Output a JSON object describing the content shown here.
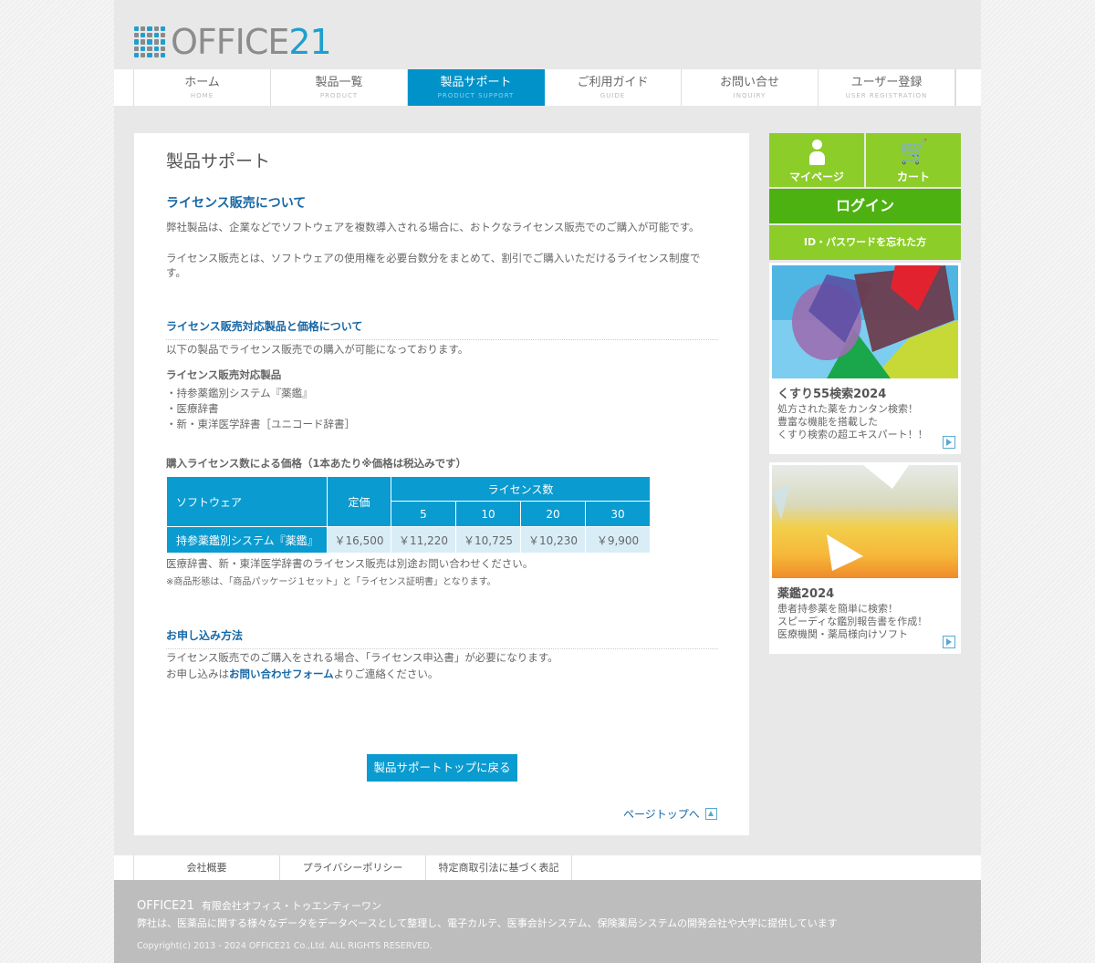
{
  "header": {
    "logo_text": "OFFICE",
    "logo_num": "21"
  },
  "nav": [
    {
      "label": "ホーム",
      "sub": "HOME"
    },
    {
      "label": "製品一覧",
      "sub": "PRODUCT"
    },
    {
      "label": "製品サポート",
      "sub": "PRODUCT SUPPORT",
      "active": true
    },
    {
      "label": "ご利用ガイド",
      "sub": "GUIDE"
    },
    {
      "label": "お問い合せ",
      "sub": "INQUIRY"
    },
    {
      "label": "ユーザー登録",
      "sub": "USER REGISTRATION"
    }
  ],
  "main": {
    "page_title": "製品サポート",
    "section_title": "ライセンス販売について",
    "intro_1": "弊社製品は、企業などでソフトウェアを複数導入される場合に、おトクなライセンス販売でのご購入が可能です。",
    "intro_2": "ライセンス販売とは、ソフトウェアの使用権を必要台数分をまとめて、割引でご購入いただけるライセンス制度です。",
    "products_heading": "ライセンス販売対応製品と価格について",
    "products_lead": "以下の製品でライセンス販売での購入が可能になっております。",
    "products_sub": "ライセンス販売対応製品",
    "products": [
      "・持参薬鑑別システム『薬鑑』",
      "・医療辞書",
      "・新・東洋医学辞書［ユニコード辞書］"
    ],
    "price_heading": "購入ライセンス数による価格（1本あたり※価格は税込みです）",
    "table": {
      "col_software": "ソフトウェア",
      "col_price": "定価",
      "col_license": "ライセンス数",
      "quantities": [
        "5",
        "10",
        "20",
        "30"
      ],
      "row_name": "持参薬鑑別システム『薬鑑』",
      "row_price": "￥16,500",
      "row_values": [
        "￥11,220",
        "￥10,725",
        "￥10,230",
        "￥9,900"
      ]
    },
    "note_1": "医療辞書、新・東洋医学辞書のライセンス販売は別途お問い合わせください。",
    "note_2": "※商品形態は、「商品パッケージ１セット」と「ライセンス証明書」となります。",
    "apply_heading": "お申し込み方法",
    "apply_1": "ライセンス販売でのご購入をされる場合、「ライセンス申込書」が必要になります。",
    "apply_2_pre": "お申し込みは",
    "apply_2_link": "お問い合わせフォーム",
    "apply_2_post": "よりご連絡ください。",
    "back_button": "製品サポートトップに戻る",
    "page_top": "ページトップへ"
  },
  "sidebar": {
    "mypage": "マイページ",
    "cart": "カート",
    "login": "ログイン",
    "forgot": "ID・パスワードを忘れた方",
    "cards": [
      {
        "title": "くすり55検索2024",
        "desc": [
          "処方された薬をカンタン検索！",
          "豊富な機能を搭載した",
          "くすり検索の超エキスパート！！"
        ]
      },
      {
        "title": "薬鑑2024",
        "desc": [
          "患者持参薬を簡単に検索！",
          "スピーディな鑑別報告書を作成！",
          "医療機関・薬局様向けソフト"
        ]
      }
    ]
  },
  "footer": {
    "links": [
      "会社概要",
      "プライバシーポリシー",
      "特定商取引法に基づく表記"
    ],
    "company": "OFFICE21",
    "company_name": "有限会社オフィス・トゥエンティーワン",
    "description": "弊社は、医薬品に関する様々なデータをデータベースとして整理し、電子カルテ、医事会計システム、保険薬局システムの開発会社や大学に提供しています",
    "copyright": "Copyright(c) 2013 - 2024 OFFICE21 Co.,Ltd. ALL RIGHTS RESERVED."
  },
  "colors": {
    "brand_blue": "#0a9bd0",
    "link_blue": "#1767a5",
    "side_green": "#8ccd2a",
    "login_green": "#4db111"
  }
}
